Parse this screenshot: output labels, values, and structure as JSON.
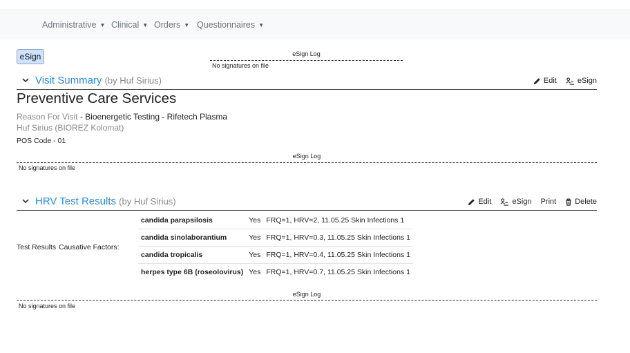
{
  "nav": {
    "items": [
      {
        "label": "Administrative"
      },
      {
        "label": "Clinical"
      },
      {
        "label": "Orders"
      },
      {
        "label": "Questionnaires"
      }
    ]
  },
  "top": {
    "esign_button": "eSign",
    "log_title": "eSign Log",
    "log_empty": "No signatures on file"
  },
  "visit": {
    "title": "Visit Summary",
    "by": "(by Huf Sirius)",
    "actions": {
      "edit": "Edit",
      "esign": "eSign"
    },
    "heading": "Preventive Care Services",
    "reason_label": "Reason For Visit",
    "reason_value": " - Bioenergetic Testing - Rifetech Plasma",
    "provider": "Huf Sirius (BIOREZ Kolomat)",
    "pos": "POS Code - 01",
    "log_title": "eSign Log",
    "log_empty": "No signatures on file"
  },
  "hrv": {
    "title": "HRV Test Results",
    "by": "(by Huf Sirius)",
    "actions": {
      "edit": "Edit",
      "esign": "eSign",
      "print": "Print",
      "delete": "Delete"
    },
    "label_results": "Test Results",
    "label_factors": "Causative Factors:",
    "rows": [
      {
        "name": "candida parapsilosis",
        "flag": "Yes",
        "detail": "FRQ=1, HRV=2, 11.05.25 Skin Infections 1"
      },
      {
        "name": "candida sinolaborantium",
        "flag": "Yes",
        "detail": "FRQ=1, HRV=0.3, 11.05.25 Skin Infections 1"
      },
      {
        "name": "candida tropicalis",
        "flag": "Yes",
        "detail": "FRQ=1, HRV=0.4, 11.05.25 Skin Infections 1"
      },
      {
        "name": "herpes type 6B (roseolovirus)",
        "flag": "Yes",
        "detail": "FRQ=1, HRV=0.7, 11.05.25 Skin Infections 1"
      }
    ],
    "log_title": "eSign Log",
    "log_empty": "No signatures on file"
  },
  "colors": {
    "link": "#2b8ad8",
    "muted": "#888888",
    "esign_button_bg": "#cfe2ff"
  }
}
